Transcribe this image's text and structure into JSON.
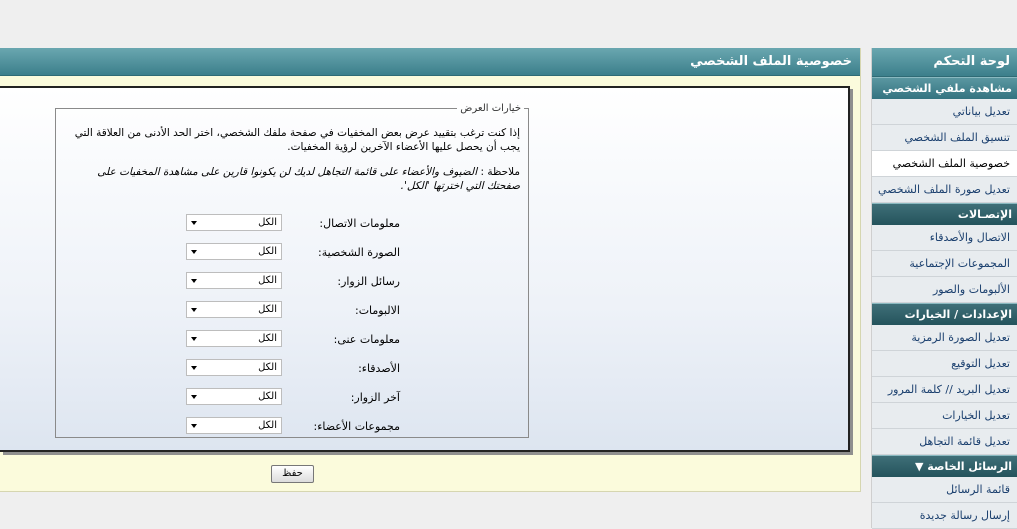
{
  "page": {
    "title": "خصوصية الملف الشخصي",
    "save_label": "حفظ"
  },
  "options": {
    "legend": "خيارات العرض",
    "description": "إذا كنت ترغب بتقييد عرض بعض المخفيات في صفحة ملفك الشخصي، اختر الحد الأدنى من العلاقة التي يجب أن يحصل عليها الأعضاء الآخرين لرؤية المخفيات.",
    "note_prefix": "ملاحظة : ",
    "note": "الضيوف والأعضاء على قائمة التجاهل لديك لن يكونوا قارين على مشاهدة المخفيات على صفحتك التي اخترتها 'الكل'.",
    "rows": [
      {
        "label": "معلومات الاتصال:",
        "value": "الكل"
      },
      {
        "label": "الصورة الشخصية:",
        "value": "الكل"
      },
      {
        "label": "رسائل الزوار:",
        "value": "الكل"
      },
      {
        "label": "الالبومات:",
        "value": "الكل"
      },
      {
        "label": "معلومات عنى:",
        "value": "الكل"
      },
      {
        "label": "الأصدقاء:",
        "value": "الكل"
      },
      {
        "label": "آخر الزوار:",
        "value": "الكل"
      },
      {
        "label": "مجموعات الأعضاء:",
        "value": "الكل"
      }
    ]
  },
  "sidebar": {
    "title": "لوحة التحكم",
    "sections": [
      {
        "title": "مشاهدة ملفي الشخصي",
        "items": [
          "تعديل بياناتي",
          "تنسيق الملف الشخصي",
          "خصوصية الملف الشخصي",
          "تعديل صورة الملف الشخصي"
        ]
      },
      {
        "title": "الإتصـالات",
        "items": [
          "الاتصال والأصدقاء",
          "المجموعات الإجتماعية",
          "الألبومات والصور"
        ]
      },
      {
        "title": "الإعدادات / الخيارات",
        "items": [
          "تعديل الصورة الرمزية",
          "تعديل التوقيع",
          "تعديل البريد // كلمة المرور",
          "تعديل الخيارات",
          "تعديل قائمة التجاهل"
        ]
      },
      {
        "title": "الرسائل الخاصة ▼",
        "items": [
          "قائمة الرسائل",
          "إرسال رسالة جديدة"
        ]
      }
    ]
  }
}
